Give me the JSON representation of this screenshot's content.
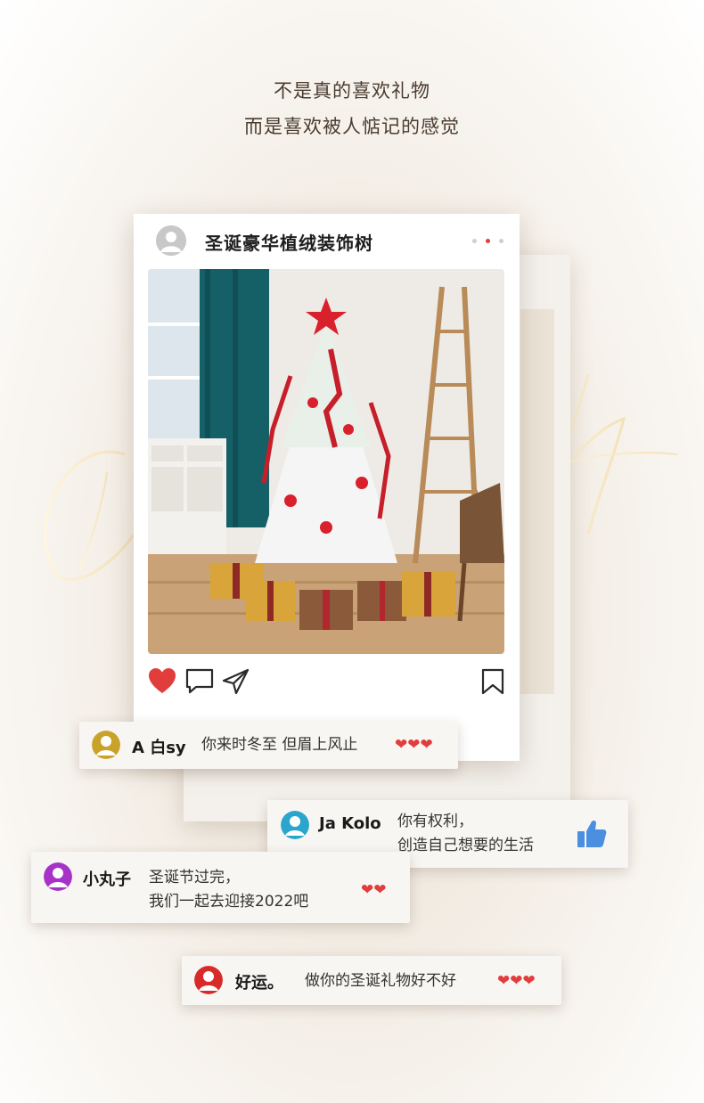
{
  "tagline": {
    "line1": "不是真的喜欢礼物",
    "line2": "而是喜欢被人惦记的感觉"
  },
  "post": {
    "title": "圣诞豪华植绒装饰树",
    "image_icon": "christmas-tree-photo",
    "actions": {
      "like_icon": "heart-icon",
      "comment_icon": "comment-icon",
      "share_icon": "send-icon",
      "save_icon": "bookmark-icon"
    }
  },
  "comments": [
    {
      "name": "A 白sy",
      "text": "你来时冬至 但眉上风止",
      "text2": "",
      "reaction": "❤❤❤",
      "avatar_color": "#c9a22a"
    },
    {
      "name": "Ja Kolo",
      "text": "你有权利，",
      "text2": "创造自己想要的生活",
      "reaction_icon": "thumbs-up-icon",
      "avatar_color": "#2aa6cc"
    },
    {
      "name": "小丸子",
      "text": "圣诞节过完，",
      "text2": "我们一起去迎接2022吧",
      "reaction": "❤❤",
      "avatar_color": "#a632c8"
    },
    {
      "name": "好运。",
      "text": "做你的圣诞礼物好不好",
      "text2": "",
      "reaction": "❤❤❤",
      "avatar_color": "#d92a2a"
    }
  ],
  "colors": {
    "accent": "#e23d3d",
    "like_blue": "#4a8fe0",
    "text_dark": "#4a3c30"
  }
}
